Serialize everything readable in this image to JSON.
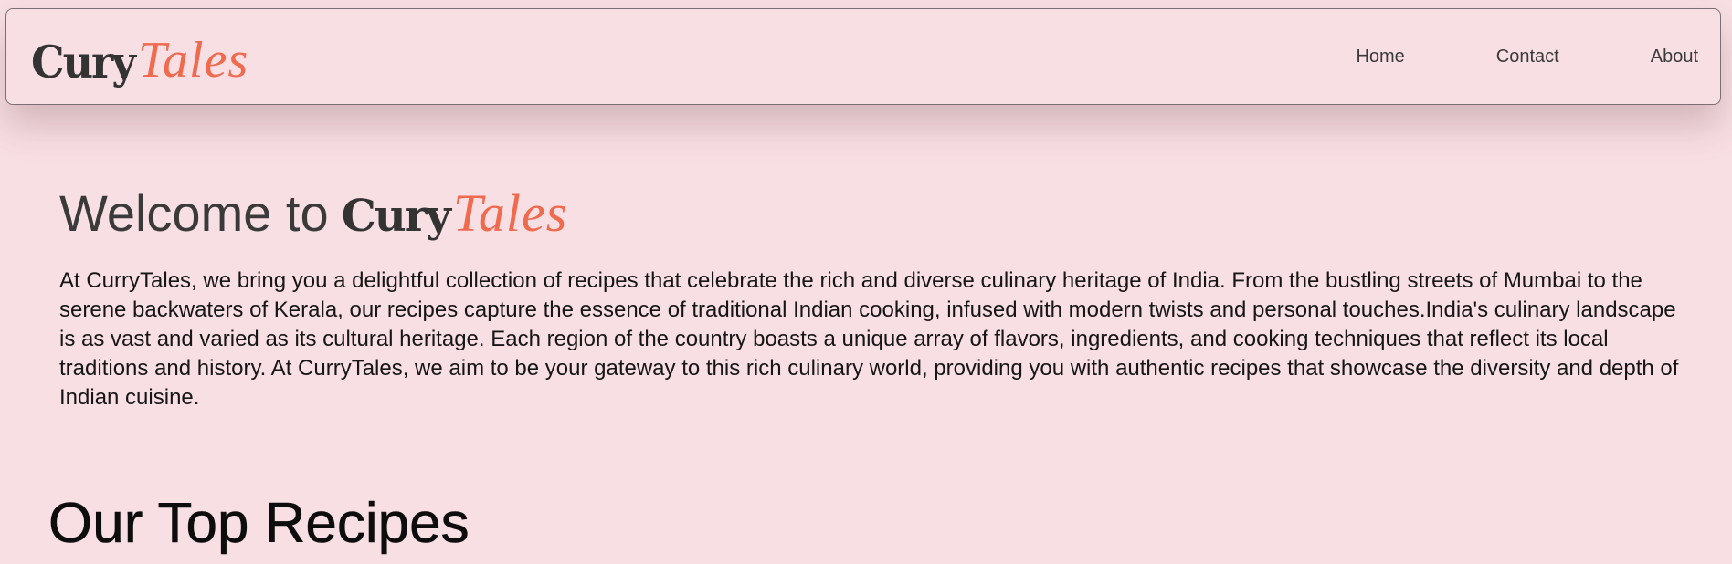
{
  "header": {
    "logo": {
      "part1": "Cury",
      "part2": "Tales"
    },
    "nav": [
      {
        "label": "Home"
      },
      {
        "label": "Contact"
      },
      {
        "label": "About"
      }
    ]
  },
  "hero": {
    "welcome_prefix": "Welcome to",
    "brand_part1": "Cury",
    "brand_part2": "Tales",
    "intro": "At CurryTales, we bring you a delightful collection of recipes that celebrate the rich and diverse culinary heritage of India. From the bustling streets of Mumbai to the serene backwaters of Kerala, our recipes capture the essence of traditional Indian cooking, infused with modern twists and personal touches.India's culinary landscape is as vast and varied as its cultural heritage. Each region of the country boasts a unique array of flavors, ingredients, and cooking techniques that reflect its local traditions and history. At CurryTales, we aim to be your gateway to this rich culinary world, providing you with authentic recipes that showcase the diversity and depth of Indian cuisine."
  },
  "top_recipes": {
    "title": "Our Top Recipes"
  },
  "colors": {
    "background": "#f8dfe3",
    "accent": "#f06a4e",
    "logo_dark": "#333333"
  }
}
